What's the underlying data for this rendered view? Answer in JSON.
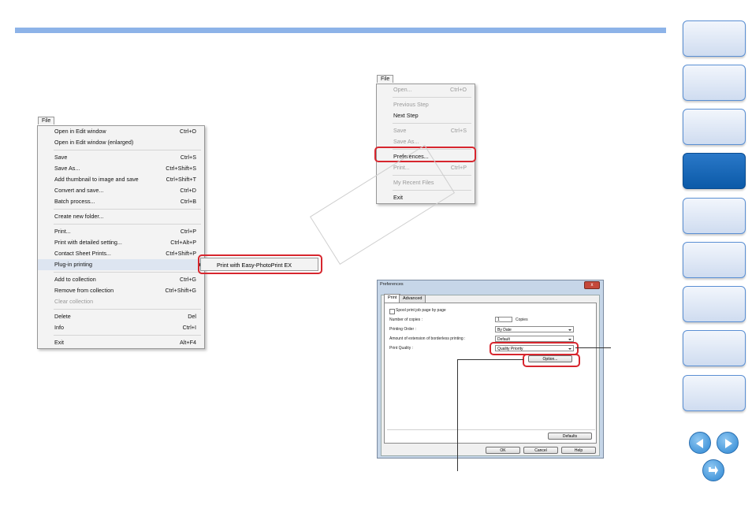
{
  "file_menu_left": {
    "tab": "File",
    "items": [
      {
        "label": "Open in Edit window",
        "shortcut": "Ctrl+O"
      },
      {
        "label": "Open in Edit window (enlarged)",
        "shortcut": ""
      },
      {
        "sep": true
      },
      {
        "label": "Save",
        "shortcut": "Ctrl+S"
      },
      {
        "label": "Save As...",
        "shortcut": "Ctrl+Shift+S"
      },
      {
        "label": "Add thumbnail to image and save",
        "shortcut": "Ctrl+Shift+T"
      },
      {
        "label": "Convert and save...",
        "shortcut": "Ctrl+D"
      },
      {
        "label": "Batch process...",
        "shortcut": "Ctrl+B"
      },
      {
        "sep": true
      },
      {
        "label": "Create new folder...",
        "shortcut": ""
      },
      {
        "sep": true
      },
      {
        "label": "Print...",
        "shortcut": "Ctrl+P"
      },
      {
        "label": "Print with detailed setting...",
        "shortcut": "Ctrl+Alt+P"
      },
      {
        "label": "Contact Sheet Prints...",
        "shortcut": "Ctrl+Shift+P"
      },
      {
        "label": "Plug-in printing",
        "shortcut": "",
        "submenu": true,
        "highlight": true
      },
      {
        "sep": true
      },
      {
        "label": "Add to collection",
        "shortcut": "Ctrl+G"
      },
      {
        "label": "Remove from collection",
        "shortcut": "Ctrl+Shift+G"
      },
      {
        "label": "Clear collection",
        "shortcut": "",
        "disabled": true
      },
      {
        "sep": true
      },
      {
        "label": "Delete",
        "shortcut": "Del"
      },
      {
        "label": "Info",
        "shortcut": "Ctrl+I"
      },
      {
        "sep": true
      },
      {
        "label": "Exit",
        "shortcut": "Alt+F4"
      }
    ],
    "submenu_item": "Print with Easy-PhotoPrint EX"
  },
  "file_menu_right": {
    "tab": "File",
    "items": [
      {
        "label": "Open...",
        "shortcut": "Ctrl+O",
        "disabled": true
      },
      {
        "sep": true
      },
      {
        "label": "Previous Step",
        "shortcut": "",
        "disabled": true
      },
      {
        "label": "Next Step",
        "shortcut": ""
      },
      {
        "sep": true
      },
      {
        "label": "Save",
        "shortcut": "Ctrl+S",
        "disabled": true
      },
      {
        "label": "Save As...",
        "shortcut": "",
        "disabled": true
      },
      {
        "sep": true
      },
      {
        "label": "Preferences...",
        "shortcut": ""
      },
      {
        "label": "Print...",
        "shortcut": "Ctrl+P",
        "disabled": true
      },
      {
        "sep": true
      },
      {
        "label": "My Recent Files",
        "shortcut": "",
        "disabled": true
      },
      {
        "sep": true
      },
      {
        "label": "Exit",
        "shortcut": ""
      }
    ]
  },
  "dialog": {
    "title": "Preferences",
    "close": "x",
    "tabs": [
      "Print",
      "Advanced"
    ],
    "spool": "Spool print job page by page",
    "copies_label": "Number of copies :",
    "copies_value": "1",
    "copies_unit": "Copies",
    "order_label": "Printing Order :",
    "order_value": "By Date",
    "ext_label": "Amount of extension of borderless printing :",
    "ext_value": "Default",
    "quality_label": "Print Quality :",
    "quality_value": "Quality Priority",
    "option_button": "Option...",
    "defaults_button": "Defaults",
    "ok_button": "OK",
    "cancel_button": "Cancel",
    "help_button": "Help"
  },
  "nav": {
    "active_index": 3,
    "count": 9
  }
}
